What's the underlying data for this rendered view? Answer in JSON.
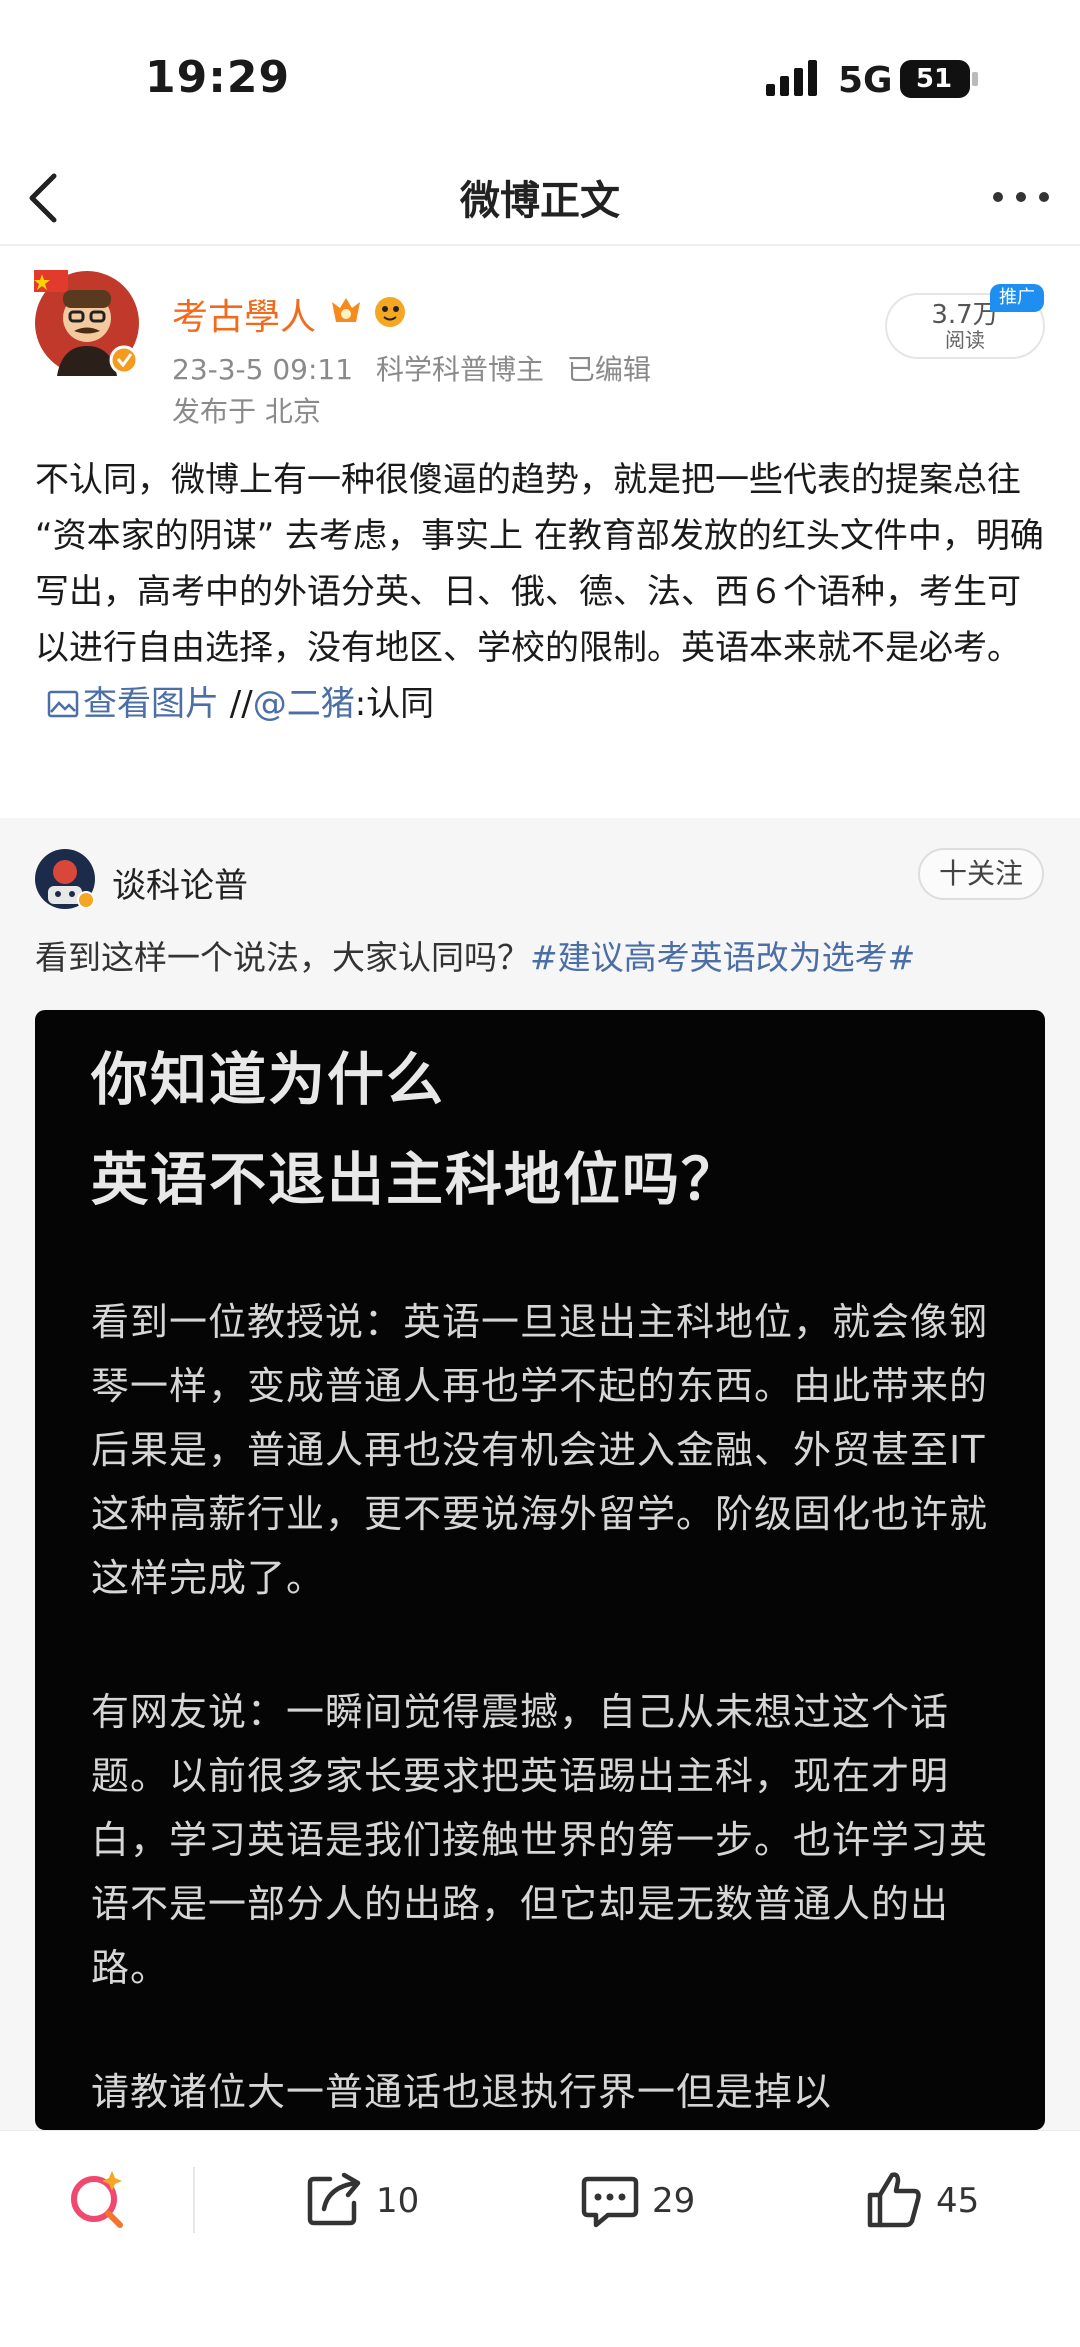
{
  "status_bar": {
    "time": "19:29",
    "network": "5G",
    "battery": "51"
  },
  "nav": {
    "title": "微博正文"
  },
  "author": {
    "name": "考古學人",
    "date": "23-3-5 09:11",
    "title": "科学科普博主",
    "edited": "已编辑",
    "location": "发布于 北京",
    "reads": "3.7万",
    "reads_label": "阅读",
    "promo": "推广"
  },
  "post": {
    "text": "不认同，微博上有一种很傻逼的趋势，就是把一些代表的提案总往 “资本家的阴谋” 去考虑，事实上 在教育部发放的红头文件中，明确写出，高考中的外语分英、日、俄、德、法、西６个语种，考生可以进行自由选择，没有地区、学校的限制。英语本来就不是必考。",
    "view_image": "查看图片",
    "sep": " //",
    "mention": "@二猪",
    "tail": ":认同"
  },
  "repost": {
    "author": "谈科论普",
    "follow": "十关注",
    "text": "看到这样一个说法，大家认同吗？",
    "hashtag": "#建议高考英语改为选考#",
    "image": {
      "title_line1": "你知道为什么",
      "title_line2": "英语不退出主科地位吗？",
      "para1": "看到一位教授说：英语一旦退出主科地位，就会像钢琴一样，变成普通人再也学不起的东西。由此带来的后果是，普通人再也没有机会进入金融、外贸甚至IT这种高薪行业，更不要说海外留学。阶级固化也许就这样完成了。",
      "para2": "有网友说：一瞬间觉得震撼，自己从未想过这个话题。以前很多家长要求把英语踢出主科，现在才明白，学习英语是我们接触世界的第一步。也许学习英语不是一部分人的出路，但它却是无数普通人的出路。",
      "para3": "请教诸位大一普通话也退执行界一但是掉以"
    }
  },
  "actions": {
    "shares": "10",
    "comments": "29",
    "likes": "45"
  },
  "colors": {
    "orange": "#f26b1d",
    "link": "#4a6ea5",
    "blue_tag": "#1e8ff0"
  }
}
